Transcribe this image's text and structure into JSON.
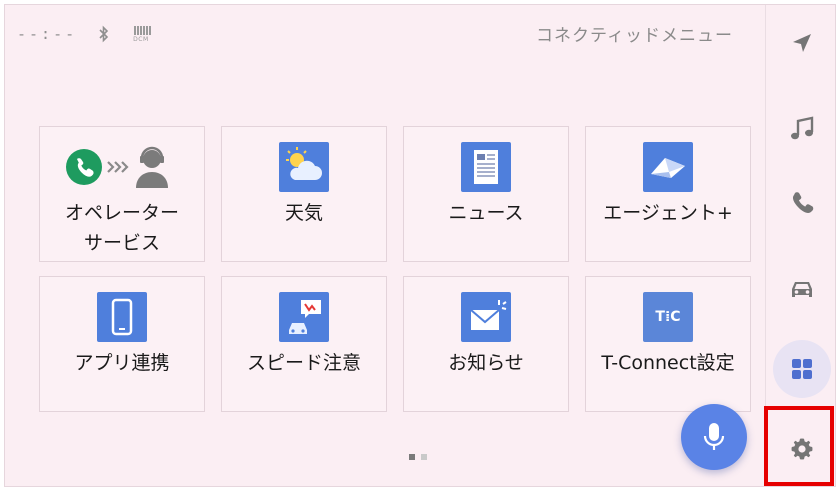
{
  "status": {
    "clock": "--:--",
    "bluetooth_icon": "bluetooth-icon",
    "signal_label": "DCM"
  },
  "header": {
    "title": "コネクティッドメニュー"
  },
  "tiles": [
    {
      "label": "オペレーター\nサービス",
      "icon": "operator-icon"
    },
    {
      "label": "天気",
      "icon": "weather-icon"
    },
    {
      "label": "ニュース",
      "icon": "news-icon"
    },
    {
      "label": "エージェント+",
      "icon": "agent-icon"
    },
    {
      "label": "アプリ連携",
      "icon": "smartphone-icon"
    },
    {
      "label": "スピード注意",
      "icon": "speed-alert-icon"
    },
    {
      "label": "お知らせ",
      "icon": "mail-icon"
    },
    {
      "label": "T-Connect設定",
      "icon": "tconnect-icon",
      "icon_text": "T⁞C"
    }
  ],
  "pager": {
    "pages": 2,
    "current": 1
  },
  "mic": {
    "icon": "microphone-icon"
  },
  "sidebar": {
    "items": [
      {
        "name": "navigation",
        "icon": "navigation-arrow-icon"
      },
      {
        "name": "audio",
        "icon": "music-note-icon"
      },
      {
        "name": "phone",
        "icon": "phone-icon"
      },
      {
        "name": "car",
        "icon": "car-icon"
      },
      {
        "name": "apps",
        "icon": "grid-icon",
        "active": true
      },
      {
        "name": "settings",
        "icon": "gear-icon"
      }
    ]
  },
  "colors": {
    "background": "#fbeef3",
    "tile_blue": "#4f7fdc",
    "accent_blue": "#5a83e6",
    "icon_grey": "#757575",
    "highlight_red": "#e60000"
  }
}
